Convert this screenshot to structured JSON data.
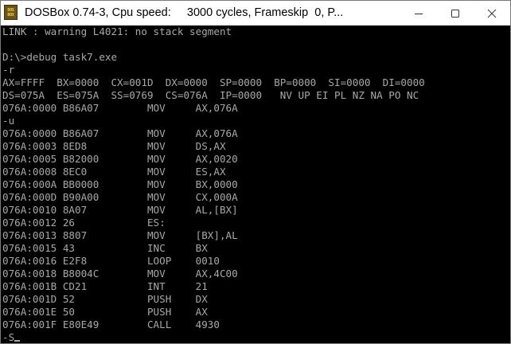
{
  "window": {
    "title": "DOSBox 0.74-3, Cpu speed:     3000 cycles, Frameskip  0, P...",
    "icon": "dosbox-icon",
    "icon_text_top": "DOS",
    "icon_text_bottom": "BOX"
  },
  "controls": {
    "minimize_icon": "minimize-icon",
    "maximize_icon": "maximize-icon",
    "close_icon": "close-icon"
  },
  "terminal": {
    "text_color": "#a8a8a8",
    "background": "#000000",
    "lines": [
      "LINK : warning L4021: no stack segment",
      "",
      "D:\\>debug task7.exe",
      "-r",
      "AX=FFFF  BX=0000  CX=001D  DX=0000  SP=0000  BP=0000  SI=0000  DI=0000",
      "DS=075A  ES=075A  SS=0769  CS=076A  IP=0000   NV UP EI PL NZ NA PO NC",
      "076A:0000 B86A07        MOV     AX,076A",
      "-u",
      "076A:0000 B86A07        MOV     AX,076A",
      "076A:0003 8ED8          MOV     DS,AX",
      "076A:0005 B82000        MOV     AX,0020",
      "076A:0008 8EC0          MOV     ES,AX",
      "076A:000A BB0000        MOV     BX,0000",
      "076A:000D B90A00        MOV     CX,000A",
      "076A:0010 8A07          MOV     AL,[BX]",
      "076A:0012 26            ES:",
      "076A:0013 8807          MOV     [BX],AL",
      "076A:0015 43            INC     BX",
      "076A:0016 E2F8          LOOP    0010",
      "076A:0018 B8004C        MOV     AX,4C00",
      "076A:001B CD21          INT     21",
      "076A:001D 52            PUSH    DX",
      "076A:001E 50            PUSH    AX",
      "076A:001F E80E49        CALL    4930"
    ],
    "prompt": "-S"
  }
}
